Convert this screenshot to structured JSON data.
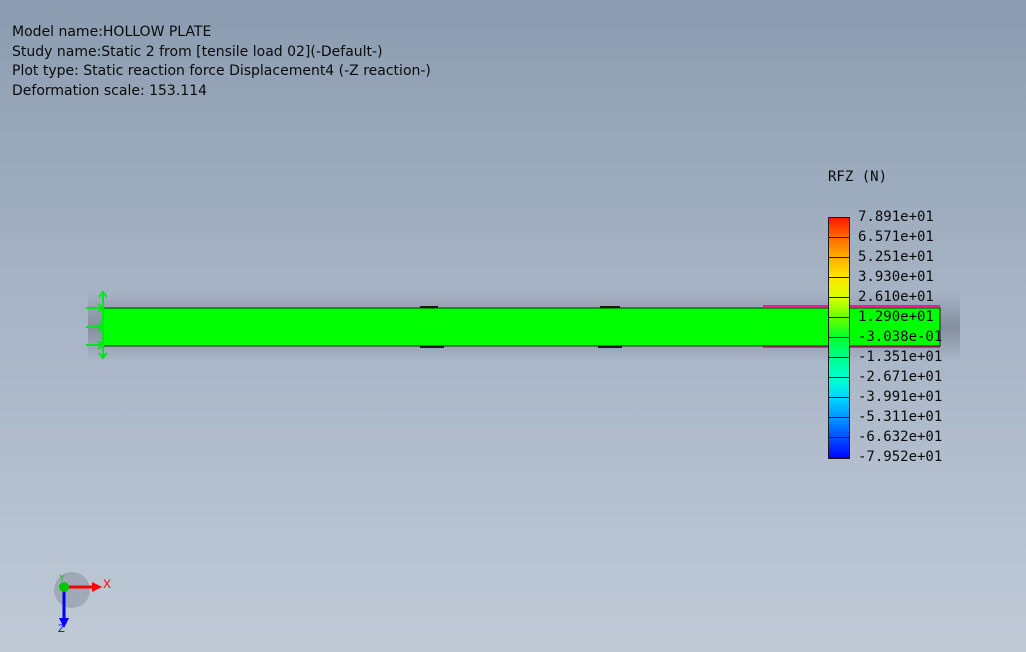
{
  "plot_info": {
    "model_name": "Model name:HOLLOW PLATE",
    "study_name": "Study name:Static 2 from [tensile load 02](-Default-)",
    "plot_type": "Plot type: Static reaction force Displacement4 (-Z reaction-)",
    "deformation_scale": "Deformation scale: 153.114"
  },
  "legend": {
    "title": "RFZ (N)",
    "values": [
      "7.891e+01",
      "6.571e+01",
      "5.251e+01",
      "3.930e+01",
      "2.610e+01",
      "1.290e+01",
      "-3.038e-01",
      "-1.351e+01",
      "-2.671e+01",
      "-3.991e+01",
      "-5.311e+01",
      "-6.632e+01",
      "-7.952e+01"
    ],
    "colors": [
      "#ff1a00",
      "#ff6a00",
      "#ffae00",
      "#ffe600",
      "#d8ff00",
      "#6aff00",
      "#00ff2a",
      "#00ff8c",
      "#00ffd0",
      "#00d8ff",
      "#0096ff",
      "#0050ff",
      "#000aff"
    ]
  },
  "model": {
    "body_color": "#00ff00",
    "fixture_color": "#00e61e",
    "load_color": "#ff1493"
  },
  "triad": {
    "x_label": "X",
    "y_label": "Y",
    "z_label": "Z",
    "x_color": "#ff0000",
    "y_color": "#00c800",
    "z_color": "#0000ff"
  }
}
